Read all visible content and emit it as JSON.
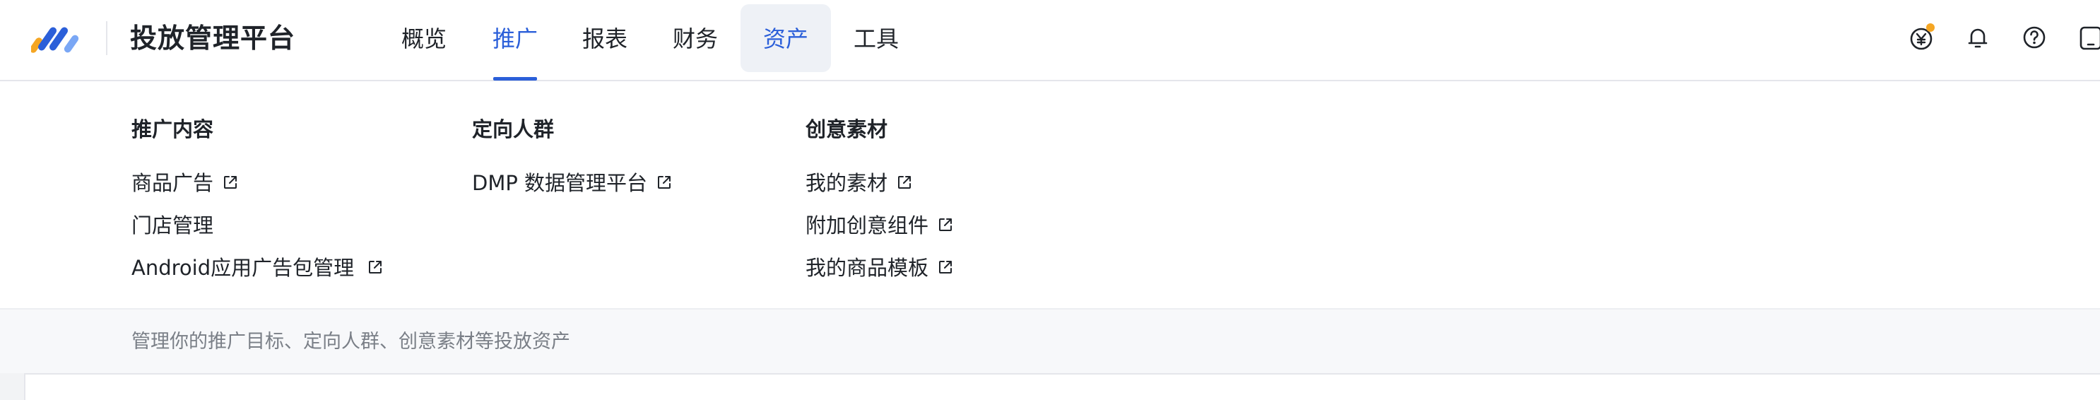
{
  "header": {
    "brand_title": "投放管理平台",
    "nav": [
      {
        "label": "概览"
      },
      {
        "label": "推广"
      },
      {
        "label": "报表"
      },
      {
        "label": "财务"
      },
      {
        "label": "资产"
      },
      {
        "label": "工具"
      }
    ],
    "active_nav": "推广",
    "hovered_nav": "资产",
    "icons": [
      "yuan-icon",
      "bell-icon",
      "help-icon",
      "device-icon"
    ],
    "notification_dot_color": "#f5a623"
  },
  "dropdown": {
    "columns": [
      {
        "title": "推广内容",
        "items": [
          {
            "label": "商品广告",
            "external": true
          },
          {
            "label": "门店管理",
            "external": false
          },
          {
            "label": "Android应用广告包管理",
            "external": true,
            "highlighted": true
          }
        ]
      },
      {
        "title": "定向人群",
        "items": [
          {
            "label": "DMP 数据管理平台",
            "external": true
          }
        ]
      },
      {
        "title": "创意素材",
        "items": [
          {
            "label": "我的素材",
            "external": true
          },
          {
            "label": "附加创意组件",
            "external": true
          },
          {
            "label": "我的商品模板",
            "external": true
          }
        ]
      }
    ],
    "footer_text": "管理你的推广目标、定向人群、创意素材等投放资产"
  },
  "colors": {
    "accent": "#2b5fd9",
    "highlight_border": "#e5382a",
    "muted_text": "#7a7f87"
  }
}
